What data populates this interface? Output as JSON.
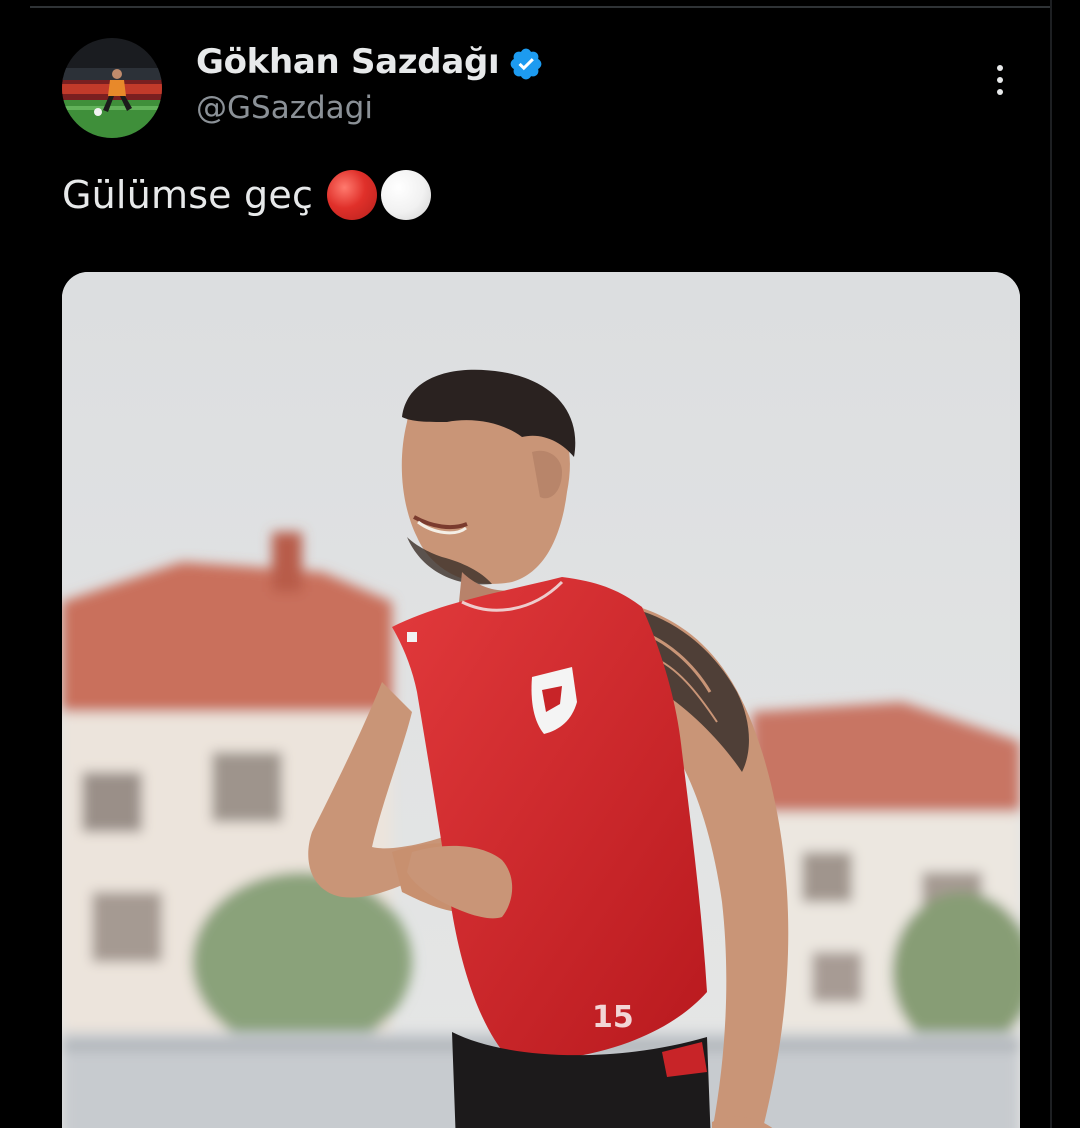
{
  "tweet": {
    "author": {
      "display_name": "Gökhan Sazdağı",
      "handle": "@GSazdagi",
      "verified": true,
      "avatar_icon": "avatar-football-player-photo"
    },
    "text": "Gülümse geç",
    "emoji": [
      "red-circle",
      "white-circle"
    ],
    "media": {
      "type": "photo",
      "description_icon": "player-photo",
      "jersey_number": "15"
    },
    "menu_icon": "more-vertical-icon"
  },
  "colors": {
    "background": "#000000",
    "primary_text": "#e7e9ea",
    "secondary_text": "#8b9197",
    "verified_blue": "#1d9bf0",
    "jersey_red": "#d42a2e"
  }
}
